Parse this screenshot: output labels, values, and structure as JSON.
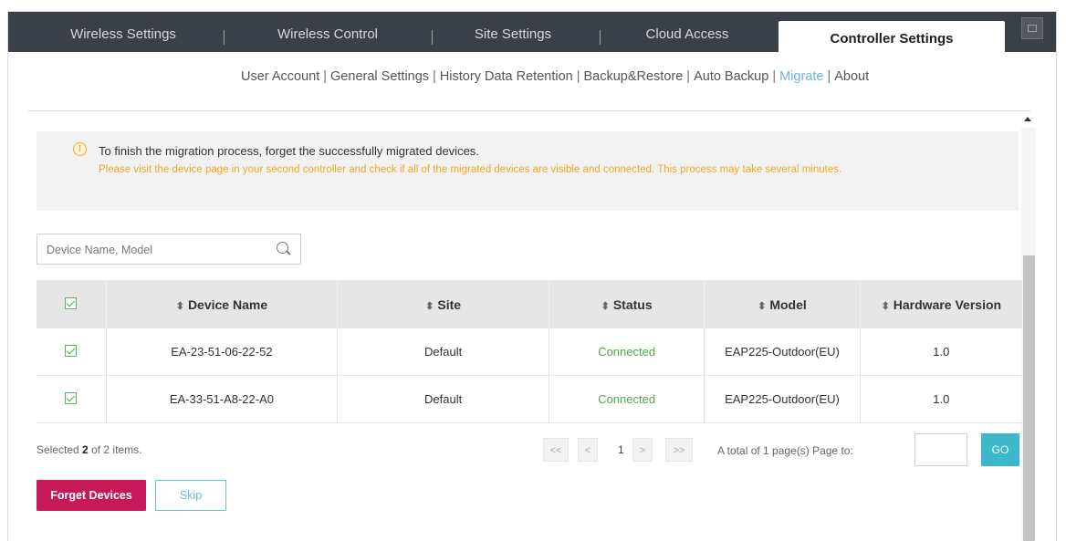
{
  "tabs": [
    {
      "label": "Wireless Settings",
      "active": false
    },
    {
      "label": "Wireless Control",
      "active": false
    },
    {
      "label": "Site Settings",
      "active": false
    },
    {
      "label": "Cloud Access",
      "active": false
    },
    {
      "label": "Controller Settings",
      "active": true
    }
  ],
  "subnav": [
    {
      "label": "User Account",
      "active": false
    },
    {
      "label": "General Settings",
      "active": false
    },
    {
      "label": "History Data Retention",
      "active": false
    },
    {
      "label": "Backup&Restore",
      "active": false
    },
    {
      "label": "Auto Backup",
      "active": false
    },
    {
      "label": "Migrate",
      "active": true
    },
    {
      "label": "About",
      "active": false
    }
  ],
  "notice": {
    "icon": "info-icon",
    "title": "To finish the migration process, forget the successfully migrated devices.",
    "detail": "Please visit the device page in your second controller and check if all of the migrated devices are visible and connected. This process may take several minutes."
  },
  "search": {
    "placeholder": "Device Name, Model",
    "value": ""
  },
  "table": {
    "headers": [
      "Device Name",
      "Site",
      "Status",
      "Model",
      "Hardware Version"
    ],
    "rows": [
      {
        "checked": true,
        "device_name": "EA-23-51-06-22-52",
        "site": "Default",
        "status": "Connected",
        "model": "EAP225-Outdoor(EU)",
        "hw": "1.0"
      },
      {
        "checked": true,
        "device_name": "EA-33-51-A8-22-A0",
        "site": "Default",
        "status": "Connected",
        "model": "EAP225-Outdoor(EU)",
        "hw": "1.0"
      }
    ]
  },
  "selection": {
    "prefix": "Selected",
    "count": "2",
    "suffix": "of 2 items."
  },
  "pagination": {
    "first": "<<",
    "prev": "<",
    "current": "1",
    "next": ">",
    "last": ">>",
    "total_text": "A total of 1 page(s)",
    "page_to_label": "Page to:",
    "go_label": "GO"
  },
  "actions": {
    "forget": "Forget Devices",
    "skip": "Skip"
  },
  "colors": {
    "accent": "#c7195a",
    "link_active": "#6cb6d8",
    "connected": "#4caa4a",
    "warning": "#f5a623",
    "go": "#3cb8cc"
  }
}
